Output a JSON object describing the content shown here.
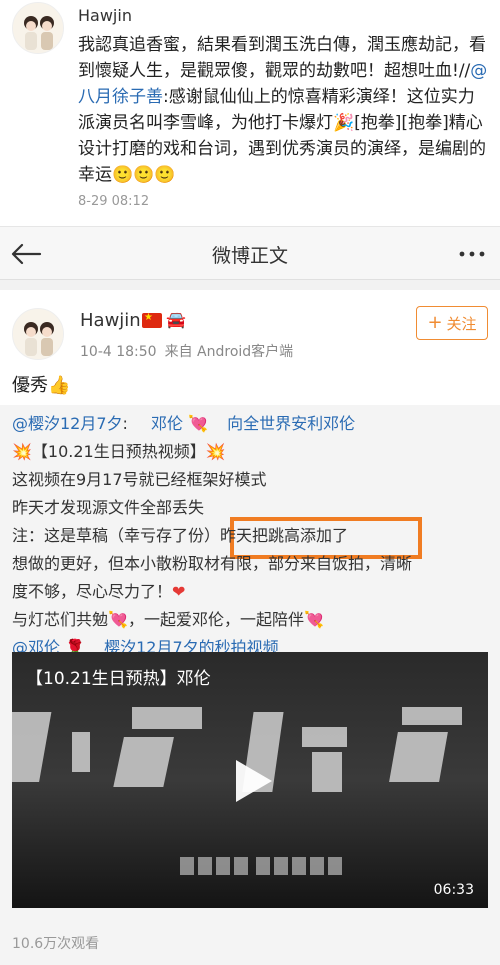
{
  "top_post": {
    "username": "Hawjin",
    "body_before_link": "我認真追香蜜，結果看到潤玉洗白傳，潤玉應劫記，看到懷疑人生，是觀眾傻，觀眾的劫數吧！超想吐血!//",
    "mention": "@八月徐子善",
    "body_after_link": ":感谢鼠仙仙上的惊喜精彩演绎！这位实力派演员名叫李雪峰，为他打卡爆灯🎉[抱拳][抱拳]精心设计打磨的戏和台词，遇到优秀演员的演绎，是编剧的幸运🙂🙂🙂",
    "time": "8-29 08:12"
  },
  "navbar": {
    "title": "微博正文",
    "back_icon": "back-arrow-icon",
    "more_icon": "more-dots-icon"
  },
  "main_post": {
    "username": "Hawjin",
    "badges": [
      "china-flag-icon",
      "car-icon"
    ],
    "time": "10-4 18:50",
    "source": "来自 Android客户端",
    "follow_label": "关注",
    "text": "優秀",
    "text_emoji": "👍"
  },
  "repost": {
    "author": "@樱汐12月7夕",
    "colon": ":",
    "mention_name": "邓伦",
    "topic": "向全世界安利邓伦",
    "line2_text": "【10.21生日预热视频】",
    "line3": "这视频在9月17号就已经框架好模式",
    "line4": "昨天才发现源文件全部丢失",
    "line5": "注：这是草稿（幸亏存了份）昨天把跳高添加了",
    "line6": "想做的更好，但本小散粉取材有限，部分来自饭拍，清晰",
    "line7": "度不够，尽心尽力了！",
    "line8": "与灯芯们共勉",
    "line8_b": "，一起爱邓伦，一起陪伴",
    "mention2": "@邓伦",
    "video_link": "樱汐12月7夕的秒拍视频"
  },
  "video": {
    "title": "【10.21生日预热】邓伦",
    "duration": "06:33"
  },
  "views": "10.6万次观看",
  "colors": {
    "link": "#2a6bb3",
    "accent_orange": "#f08c33",
    "highlight_box": "#f07c22",
    "repost_bg": "#f4f4f4"
  }
}
